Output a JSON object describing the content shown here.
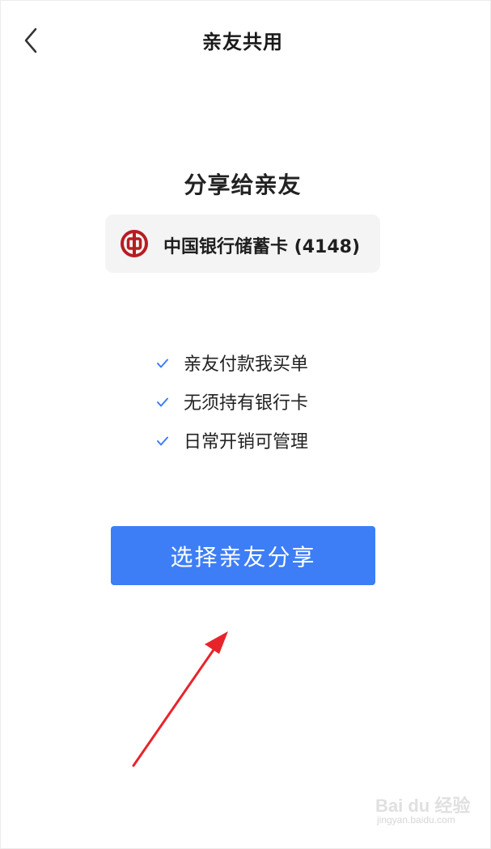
{
  "header": {
    "title": "亲友共用",
    "back_icon": "chevron-left-icon"
  },
  "share": {
    "heading": "分享给亲友",
    "card": {
      "bank_logo_icon": "boc-logo-icon",
      "name": "中国银行储蓄卡 (4148)"
    }
  },
  "features": [
    {
      "icon": "check-icon",
      "label": "亲友付款我买单"
    },
    {
      "icon": "check-icon",
      "label": "无须持有银行卡"
    },
    {
      "icon": "check-icon",
      "label": "日常开销可管理"
    }
  ],
  "action": {
    "button_label": "选择亲友分享"
  },
  "watermark": {
    "logo_text": "Bai du 经验",
    "url": "jingyan.baidu.com"
  },
  "colors": {
    "primary": "#3d7ef6",
    "check": "#3d7ef6",
    "bank_red": "#b81c22",
    "annotation_arrow": "#e8242b",
    "card_bg": "#f4f4f4"
  }
}
